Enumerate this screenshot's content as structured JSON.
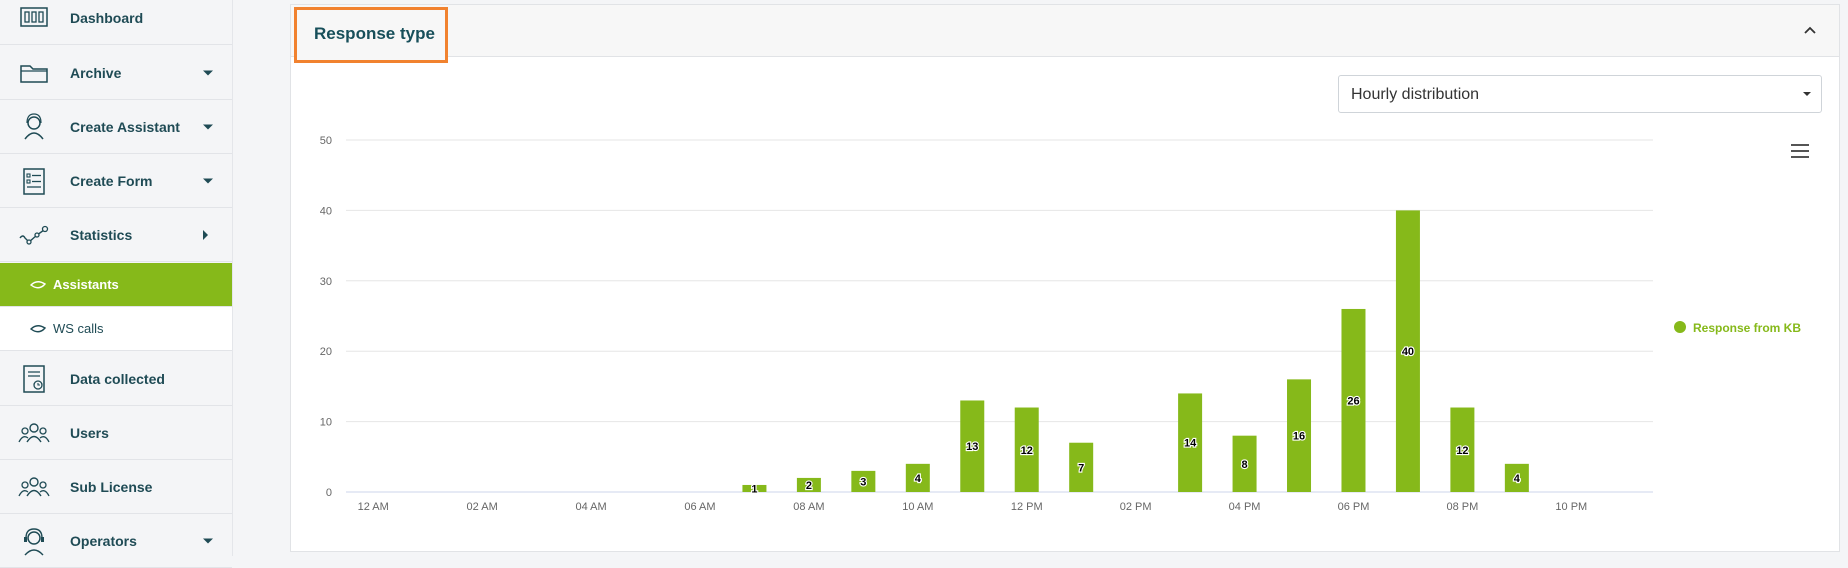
{
  "sidebar": {
    "items": [
      {
        "label": "Dashboard",
        "icon": "dashboard-icon",
        "arrow": ""
      },
      {
        "label": "Archive",
        "icon": "folder-icon",
        "arrow": "down"
      },
      {
        "label": "Create Assistant",
        "icon": "assistant-icon",
        "arrow": "down"
      },
      {
        "label": "Create Form",
        "icon": "form-icon",
        "arrow": "down"
      },
      {
        "label": "Statistics",
        "icon": "statistics-icon",
        "arrow": "right"
      }
    ],
    "sub_items": [
      {
        "label": "Assistants",
        "active": true
      },
      {
        "label": "WS calls",
        "active": false
      }
    ],
    "items2": [
      {
        "label": "Data collected",
        "icon": "data-collected-icon",
        "arrow": ""
      },
      {
        "label": "Users",
        "icon": "users-icon",
        "arrow": ""
      },
      {
        "label": "Sub License",
        "icon": "sub-license-icon",
        "arrow": ""
      },
      {
        "label": "Operators",
        "icon": "operators-icon",
        "arrow": "down"
      }
    ]
  },
  "panel": {
    "title": "Response type",
    "select_value": "Hourly distribution"
  },
  "colors": {
    "accent": "#86b91a",
    "highlight": "#f1822f",
    "text": "#1f4b55"
  },
  "chart_data": {
    "type": "bar",
    "categories": [
      "12 AM",
      "01 AM",
      "02 AM",
      "03 AM",
      "04 AM",
      "05 AM",
      "06 AM",
      "07 AM",
      "08 AM",
      "09 AM",
      "10 AM",
      "11 AM",
      "12 PM",
      "01 PM",
      "02 PM",
      "03 PM",
      "04 PM",
      "05 PM",
      "06 PM",
      "07 PM",
      "08 PM",
      "09 PM",
      "10 PM",
      "11 PM"
    ],
    "x_tick_labels": [
      "12 AM",
      "02 AM",
      "04 AM",
      "06 AM",
      "08 AM",
      "10 AM",
      "12 PM",
      "02 PM",
      "04 PM",
      "06 PM",
      "08 PM",
      "10 PM"
    ],
    "series": [
      {
        "name": "Response from KB",
        "color": "#86b91a",
        "values": [
          0,
          0,
          0,
          0,
          0,
          0,
          0,
          1,
          2,
          3,
          4,
          13,
          12,
          7,
          0,
          14,
          8,
          16,
          26,
          40,
          12,
          4,
          0,
          0
        ]
      }
    ],
    "y_ticks": [
      0,
      10,
      20,
      30,
      40,
      50
    ],
    "ylim": [
      0,
      50
    ],
    "grid": true,
    "legend": "right"
  }
}
